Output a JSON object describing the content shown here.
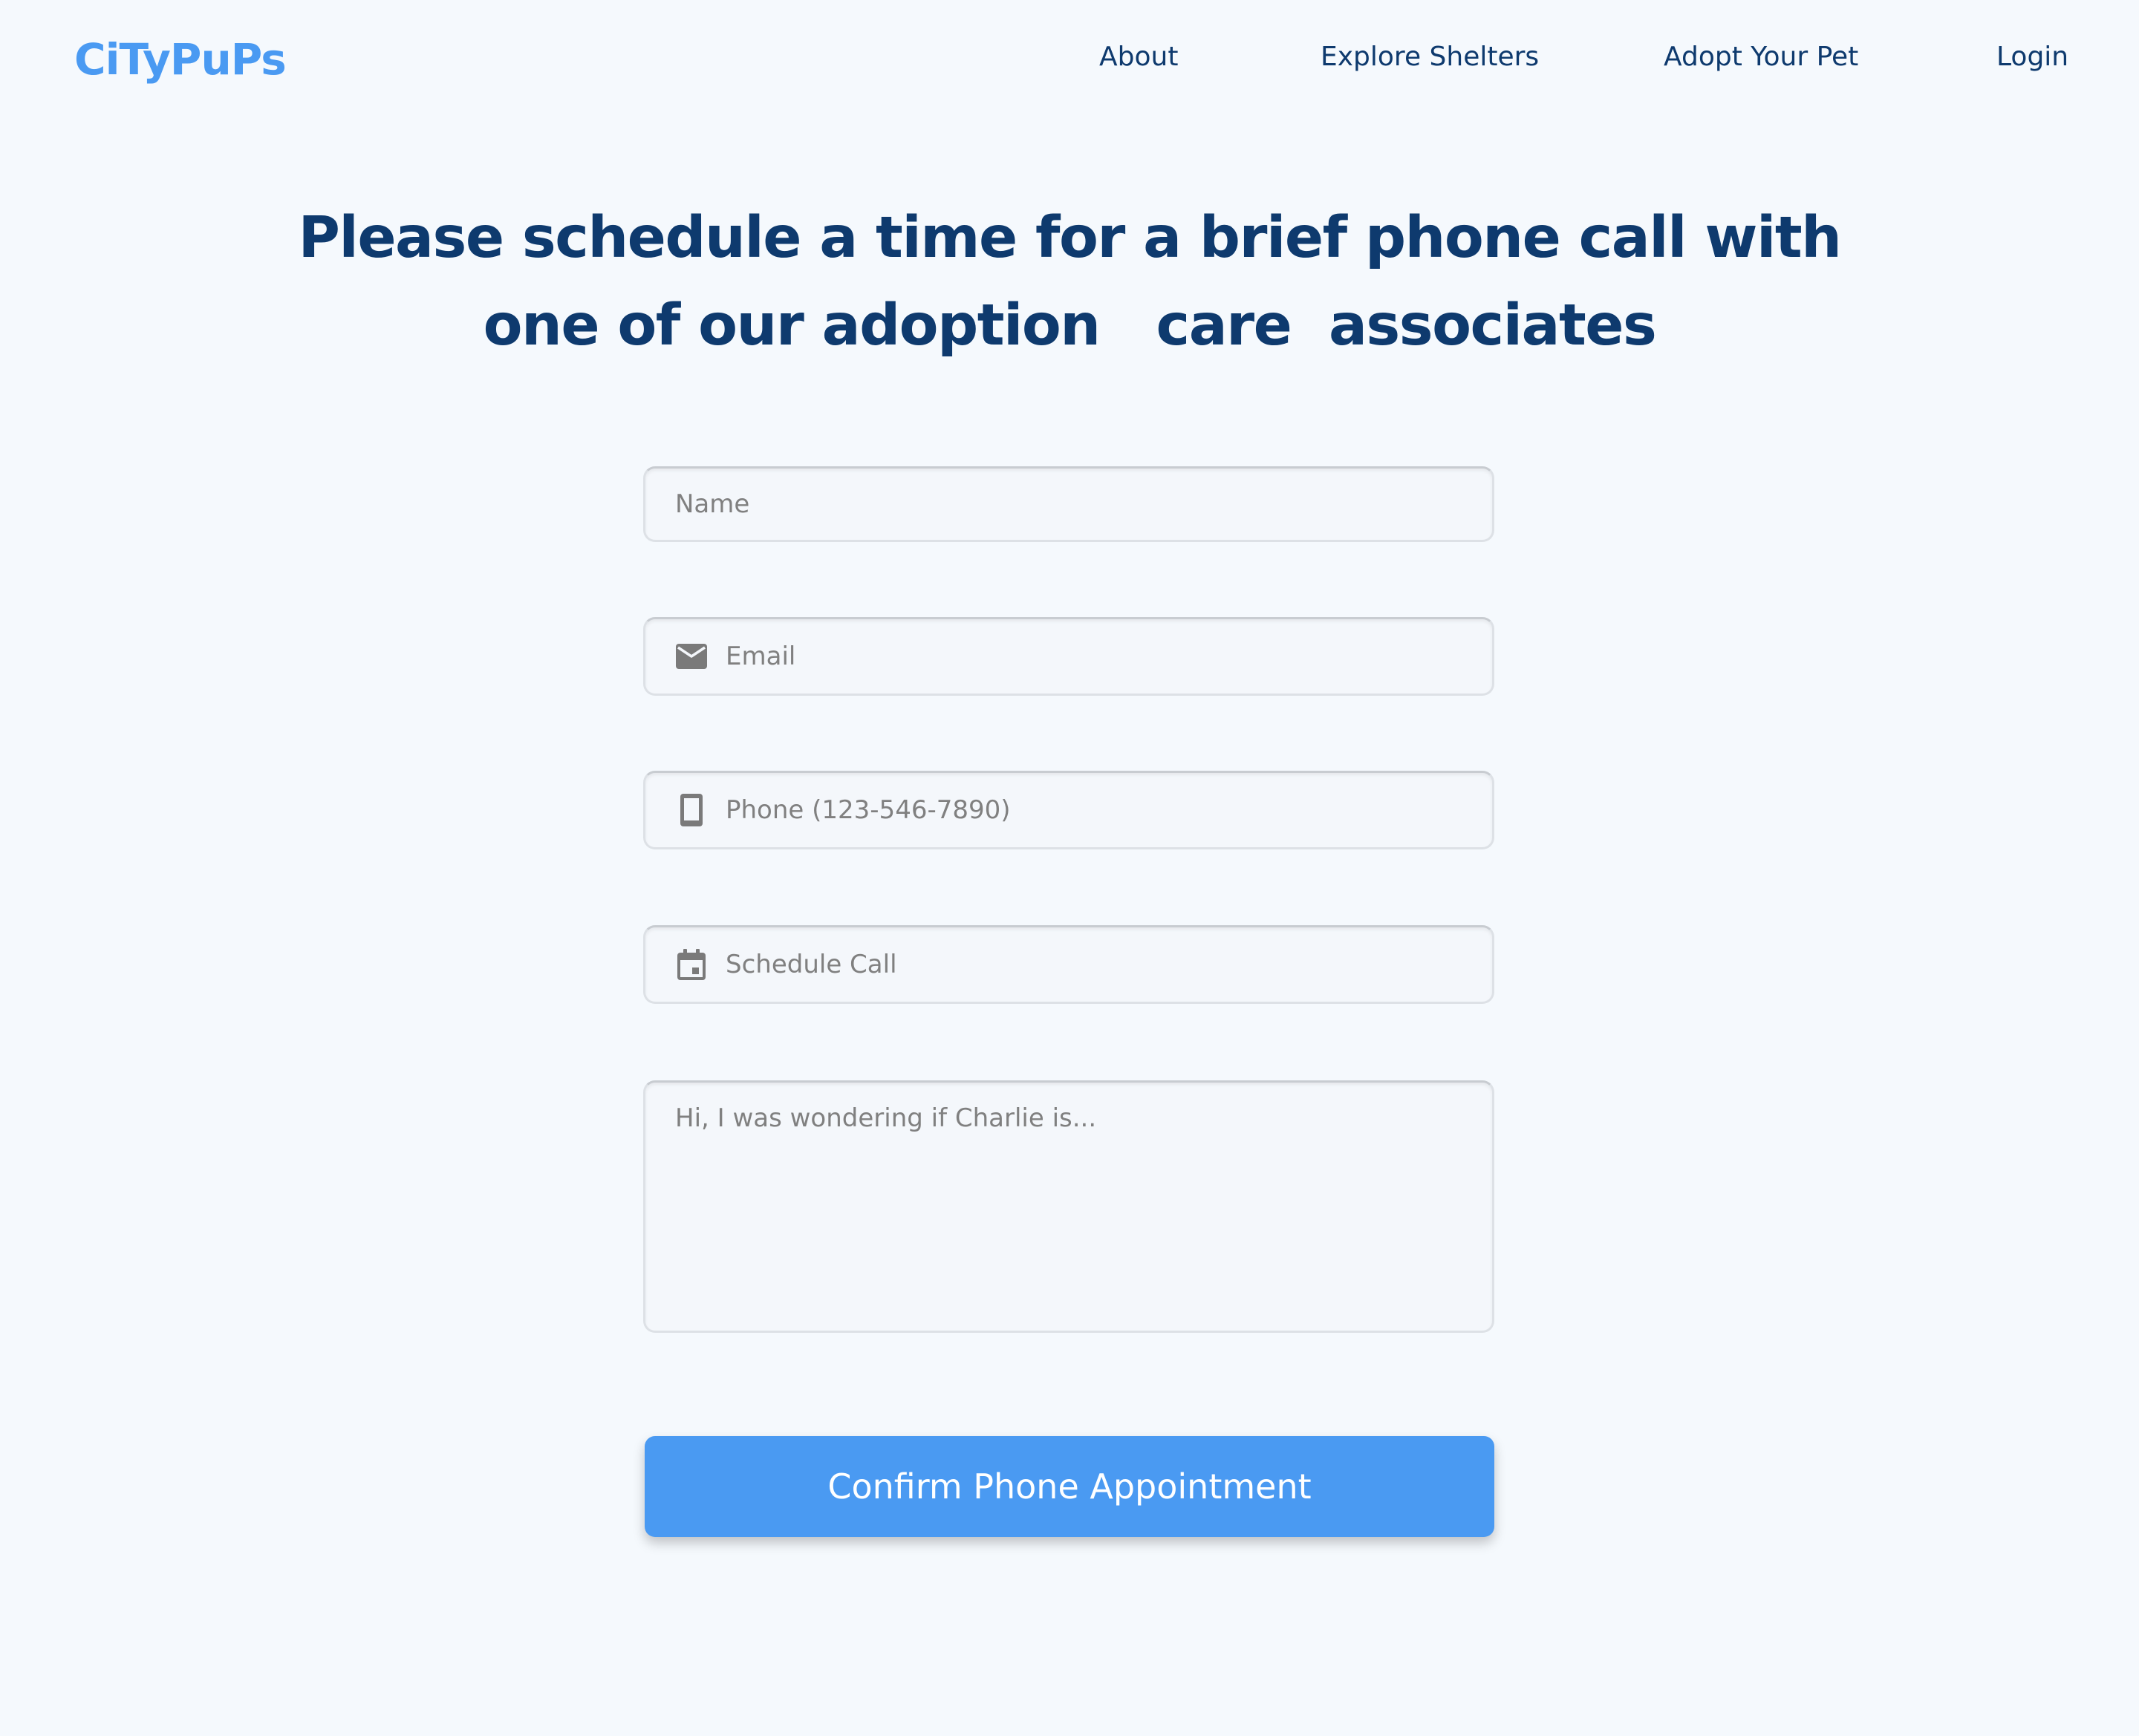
{
  "header": {
    "logo": "CiTyPuPs",
    "nav": {
      "about": "About",
      "explore": "Explore Shelters",
      "adopt": "Adopt Your Pet",
      "login": "Login"
    }
  },
  "headline": {
    "line1": "Please schedule a time for a brief phone call with",
    "line2": "one of our adoption   care  associates"
  },
  "form": {
    "name_placeholder": "Name",
    "email_placeholder": "Email",
    "email_icon": "mail-icon",
    "phone_placeholder": "Phone (123-546-7890)",
    "phone_icon": "smartphone-icon",
    "schedule_placeholder": "Schedule Call",
    "schedule_icon": "calendar-icon",
    "message_placeholder": "Hi, I was wondering if Charlie is...",
    "submit_label": "Confirm Phone Appointment"
  },
  "colors": {
    "background": "#f5f9fd",
    "brand": "#4a9af2",
    "heading": "#0e3a6e",
    "placeholder": "#808080"
  }
}
